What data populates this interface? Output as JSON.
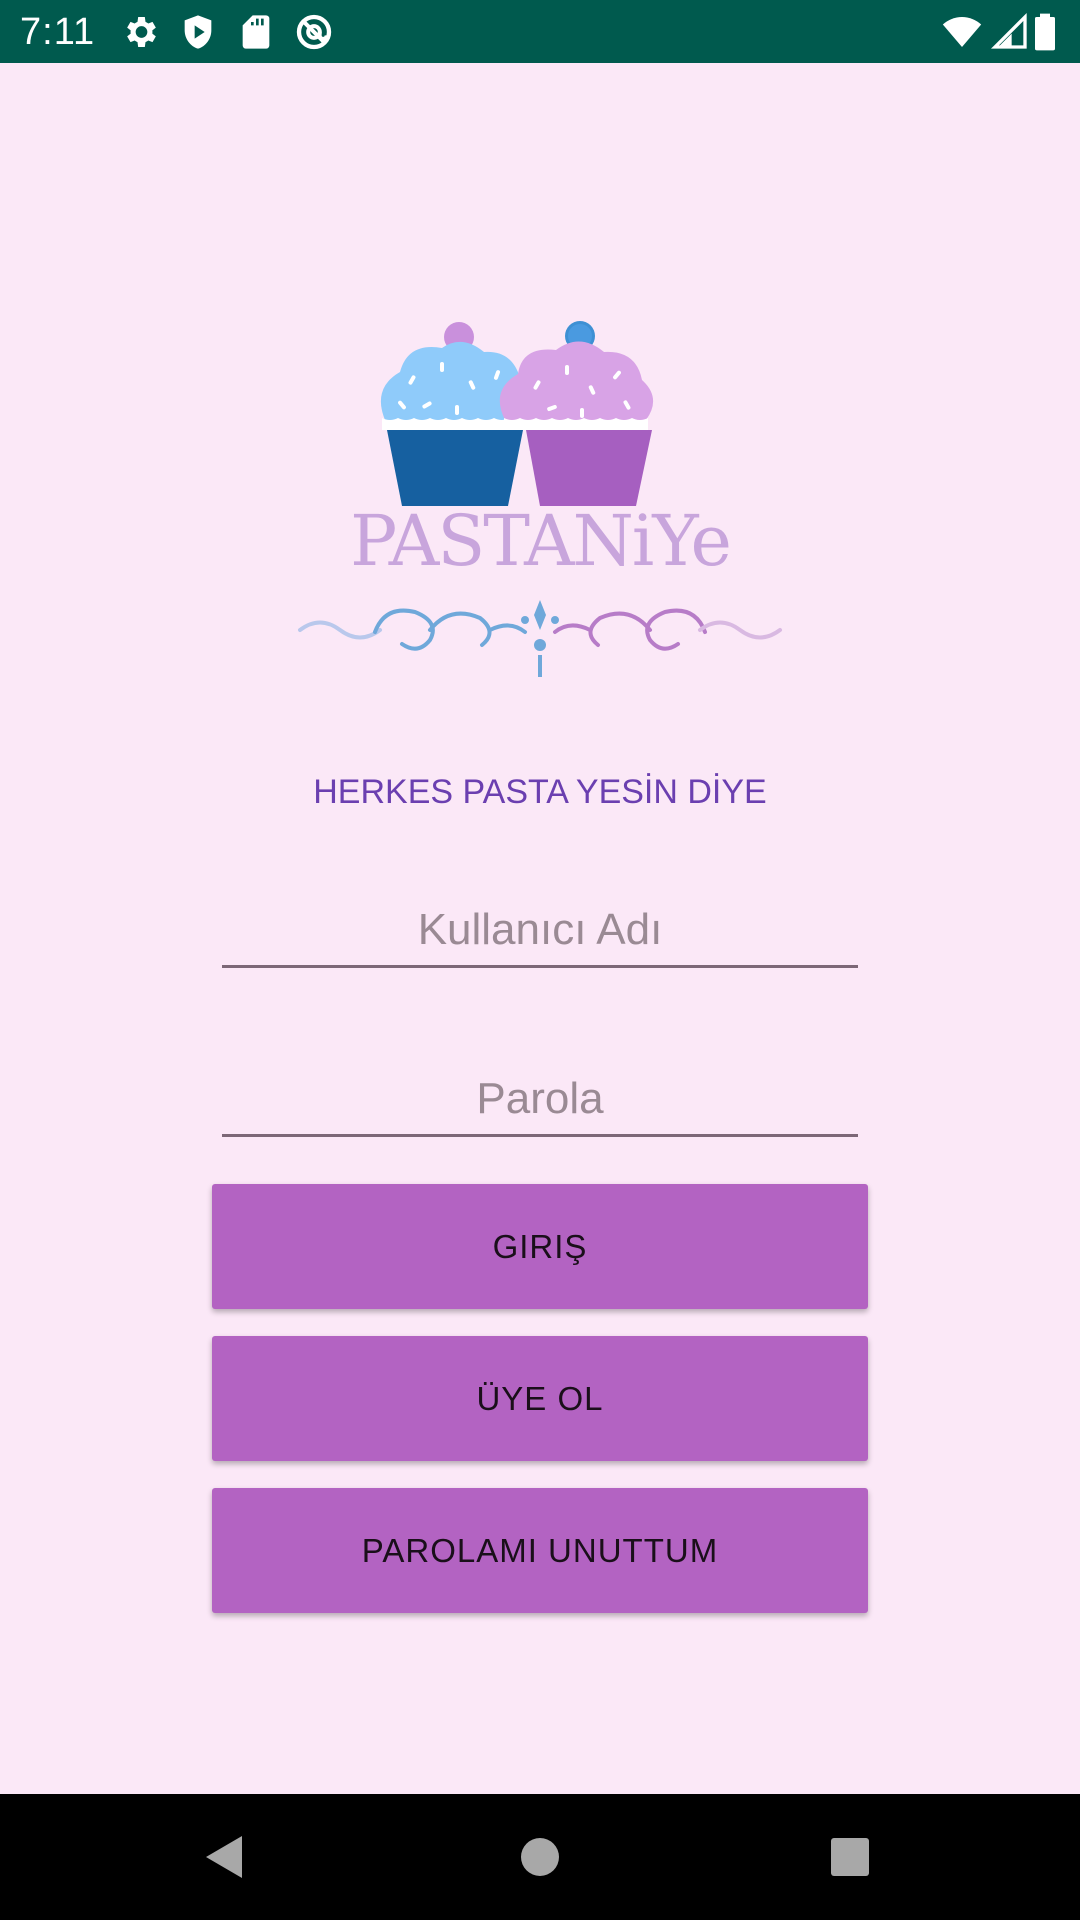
{
  "status_bar": {
    "time": "7:11",
    "icons": [
      "gear-icon",
      "shield-play-icon",
      "sd-card-icon",
      "at-sign-icon",
      "wifi-icon",
      "cellular-signal-icon",
      "battery-icon"
    ]
  },
  "logo": {
    "text": "PASTANiYe",
    "colors": {
      "cupcake_left_frosting": "#8FCBFA",
      "cupcake_left_wrapper": "#1660A0",
      "cupcake_right_frosting": "#D8A3E6",
      "cupcake_right_wrapper": "#A65FC0",
      "cherry_left": "#C990DC",
      "cherry_right": "#3E90D4",
      "text": "#C8A5DC"
    }
  },
  "tagline": "HERKES PASTA YESİN DİYE",
  "form": {
    "username_placeholder": "Kullanıcı Adı",
    "password_placeholder": "Parola"
  },
  "buttons": {
    "login": "GIRIŞ",
    "register": "ÜYE OL",
    "forgot_password": "PAROLAMI UNUTTUM"
  },
  "nav_bar": {
    "icons": [
      "back-icon",
      "home-icon",
      "recents-icon"
    ]
  },
  "colors": {
    "background": "#FBE8F7",
    "status_bar": "#005A4E",
    "tagline": "#6B3FB0",
    "button": "#B363C2"
  }
}
